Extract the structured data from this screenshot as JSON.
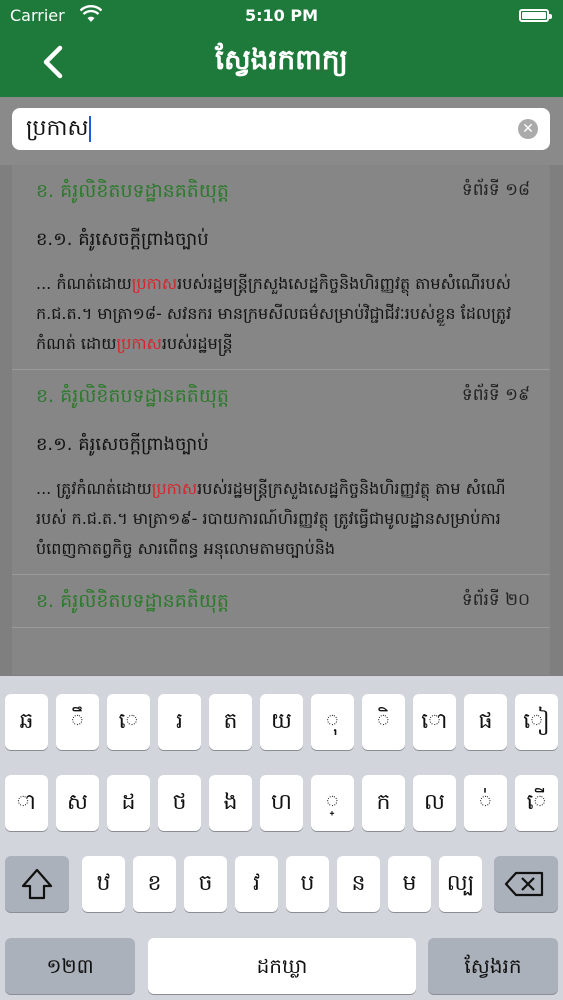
{
  "status": {
    "carrier": "Carrier",
    "time": "5:10 PM"
  },
  "header": {
    "title": "ស្វែងរកពាក្យ"
  },
  "search": {
    "value": "ប្រកាស"
  },
  "results": [
    {
      "title": "ខ. គំរូលិខិតបទដ្ឋានគតិយុត្ត",
      "page": "ទំព័រទី ១៨",
      "subtitle": "ខ.១. គំរូសេចក្តីព្រាងច្បាប់",
      "body_before": "... កំណត់ដោយ",
      "hl1": "ប្រកាស",
      "body_mid": "របស់រដ្ឋមន្ត្រីក្រសួងសេដ្ឋកិច្ចនិងហិរញ្ញវត្ថុ តាមសំណើរបស់ ក.ជ.ត.។ មាត្រា១៨- សវនករ មានក្រមសីលធម៌សម្រាប់វិជ្ជាជីវៈរបស់ខ្លួន ដែលត្រូវកំណត់ ដោយ",
      "hl2": "ប្រកាស",
      "body_after": "របស់រដ្ឋមន្ត្រី"
    },
    {
      "title": "ខ. គំរូលិខិតបទដ្ឋានគតិយុត្ត",
      "page": "ទំព័រទី ១៩",
      "subtitle": "ខ.១. គំរូសេចក្តីព្រាងច្បាប់",
      "body_before": "... ត្រូវកំណត់ដោយ",
      "hl1": "ប្រកាស",
      "body_mid": "របស់រដ្ឋមន្ត្រីក្រសួងសេដ្ឋកិច្ចនិងហិរញ្ញវត្ថុ តាម សំណើរបស់ ក.ជ.ត.។ មាត្រា១៩- របាយការណ៍ហិរញ្ញវត្ថុ ត្រូវធ្វើជាមូលដ្ឋានសម្រាប់ការបំពេញកាតព្វកិច្ច សារពើពន្ធ អនុលោមតាមច្បាប់និង",
      "hl2": "",
      "body_after": ""
    },
    {
      "title": "ខ. គំរូលិខិតបទដ្ឋានគតិយុត្ត",
      "page": "ទំព័រទី ២០"
    }
  ],
  "keyboard": {
    "row1": [
      "ឆ",
      "ឹ",
      "េ",
      "រ",
      "ត",
      "យ",
      "ុ",
      "ិ",
      "ោ",
      "ផ",
      "ៀ"
    ],
    "row2": [
      "ា",
      "ស",
      "ដ",
      "ថ",
      "ង",
      "ហ",
      "្",
      "ក",
      "ល",
      "់",
      "ើ"
    ],
    "row3": [
      "ឋ",
      "ខ",
      "ច",
      "វ",
      "ប",
      "ន",
      "ម",
      "ល្ប"
    ],
    "numbers": "១២៣",
    "space": "ដកឃ្លា",
    "search": "ស្វែងរក"
  }
}
